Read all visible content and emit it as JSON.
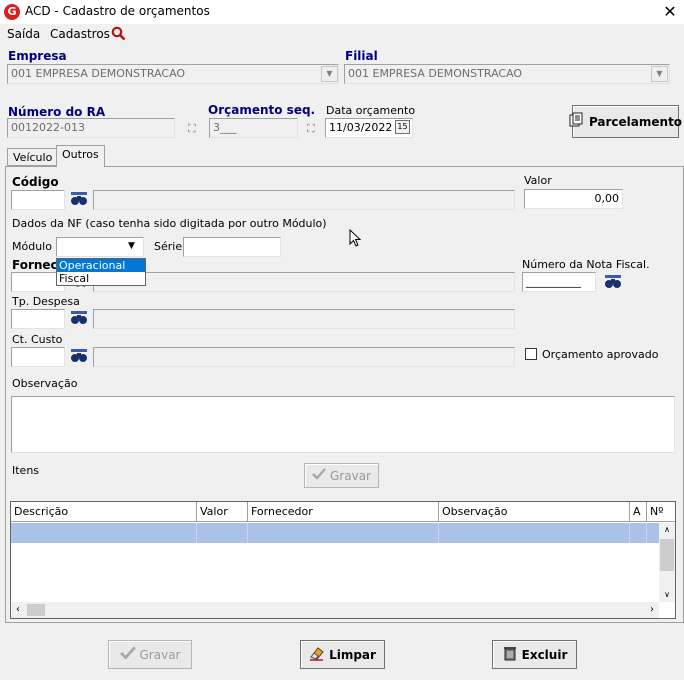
{
  "window": {
    "title": "ACD - Cadastro de orçamentos",
    "logo": "G",
    "close": "✕"
  },
  "menu": {
    "items": [
      "Saída",
      "Cadastros"
    ],
    "search_icon": "search-icon"
  },
  "empresa": {
    "label": "Empresa",
    "value": "001 EMPRESA DEMONSTRACAO"
  },
  "filial": {
    "label": "Filial",
    "value": "001 EMPRESA DEMONSTRACAO"
  },
  "numero_ra": {
    "label": "Número do RA",
    "value": "0012022-013"
  },
  "orcamento_seq": {
    "label": "Orçamento seq.",
    "value": "3___"
  },
  "data_orcamento": {
    "label": "Data orçamento",
    "value": "11/03/2022",
    "cal": "15"
  },
  "parcelamento_label": "Parcelamento",
  "tabs": [
    "Veículo",
    "Outros"
  ],
  "codigo": {
    "label": "Código",
    "value": "",
    "desc": ""
  },
  "valor": {
    "label": "Valor",
    "value": "0,00"
  },
  "nf_note": "Dados da NF (caso tenha sido digitada por outro Módulo)",
  "modulo": {
    "label": "Módulo",
    "value": "",
    "options": [
      "Operacional",
      "Fiscal"
    ]
  },
  "serie": {
    "label": "Série",
    "value": ""
  },
  "fornecedor": {
    "label": "Fornecedor",
    "label_visible": "Fornece"
  },
  "numero_nota": {
    "label": "Número da Nota Fiscal.",
    "value": "__________"
  },
  "tp_despesa": {
    "label": "Tp. Despesa"
  },
  "ct_custo": {
    "label": "Ct. Custo"
  },
  "orcamento_aprovado": {
    "label": "Orçamento aprovado",
    "checked": false
  },
  "observacao": {
    "label": "Observação",
    "value": ""
  },
  "itens": {
    "label": "Itens",
    "gravar_label": "Gravar"
  },
  "grid": {
    "columns": [
      "Descrição",
      "Valor",
      "Fornecedor",
      "Observação",
      "A",
      "Nº"
    ]
  },
  "bottom": {
    "gravar": "Gravar",
    "limpar": "Limpar",
    "excluir": "Excluir"
  }
}
